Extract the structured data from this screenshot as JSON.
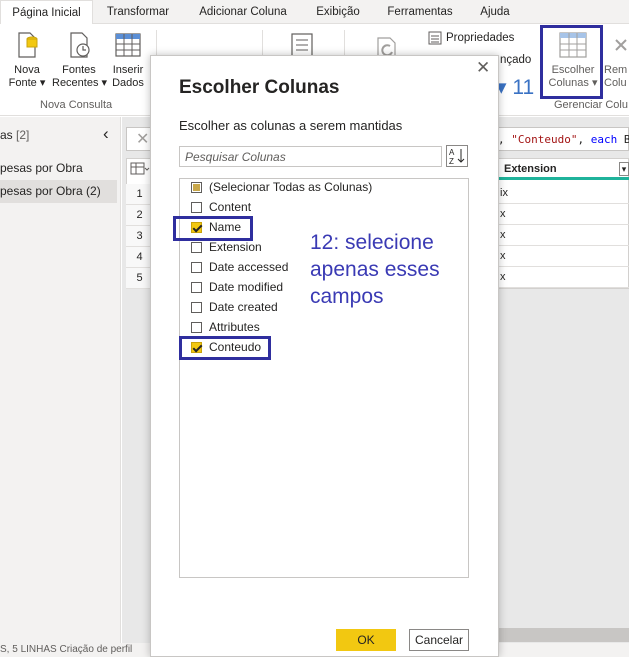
{
  "ribbon": {
    "tabs": [
      "Página Inicial",
      "Transformar",
      "Adicionar Coluna",
      "Exibição",
      "Ferramentas",
      "Ajuda"
    ],
    "active_tab": "Página Inicial",
    "buttons": {
      "nova_fonte": [
        "Nova",
        "Fonte ▾"
      ],
      "fontes_recentes": [
        "Fontes",
        "Recentes ▾"
      ],
      "inserir_dados": [
        "Inserir",
        "Dados"
      ],
      "escolher_colunas": [
        "Escolher",
        "Colunas ▾"
      ],
      "remover_colunas": [
        "Rem",
        "Colu"
      ]
    },
    "propriedades": "Propriedades",
    "avancado_fragment": "nçado",
    "eleven_fragment": "▾ 11",
    "groups": {
      "nova_consulta": "Nova Consulta",
      "gerenciar_colunas": "Gerenciar Colu"
    }
  },
  "left_panel": {
    "title": "as",
    "count": "[2]",
    "items": [
      "pesas por Obra",
      "pesas por Obra (2)"
    ],
    "selected_index": 1
  },
  "formula_bar": {
    "prefix": ", ",
    "string": "\"Conteudo\"",
    "mid": ", ",
    "keyword": "each",
    "suffix": " B"
  },
  "grid": {
    "row_numbers": [
      "1",
      "2",
      "3",
      "4",
      "5"
    ],
    "column_header": "Extension",
    "cells": [
      "ix",
      "x",
      "x",
      "x",
      "x"
    ]
  },
  "status_bar": "S, 5 LINHAS    Criação de perfil",
  "dialog": {
    "title": "Escolher Colunas",
    "subtitle": "Escolher as colunas a serem mantidas",
    "search_placeholder": "Pesquisar Colunas",
    "columns": [
      {
        "label": "(Selecionar Todas as Colunas)",
        "state": "partial"
      },
      {
        "label": "Content",
        "state": "unchecked"
      },
      {
        "label": "Name",
        "state": "checked"
      },
      {
        "label": "Extension",
        "state": "unchecked"
      },
      {
        "label": "Date accessed",
        "state": "unchecked"
      },
      {
        "label": "Date modified",
        "state": "unchecked"
      },
      {
        "label": "Date created",
        "state": "unchecked"
      },
      {
        "label": "Attributes",
        "state": "unchecked"
      },
      {
        "label": "Conteudo",
        "state": "checked"
      }
    ],
    "ok_label": "OK",
    "cancel_label": "Cancelar",
    "close_glyph": "✕"
  },
  "annotation": "12: selecione apenas esses campos",
  "colors": {
    "accent_yellow": "#f2c811",
    "highlight_box": "#2f2e9e",
    "annotation_text": "#3a3ab4",
    "column_underline": "#1fb39b"
  },
  "icons": {
    "nova_fonte": "database-icon",
    "fontes_recentes": "recent-file-icon",
    "inserir_dados": "table-icon",
    "escolher_colunas": "choose-columns-icon",
    "sort": "sort-az-icon"
  }
}
